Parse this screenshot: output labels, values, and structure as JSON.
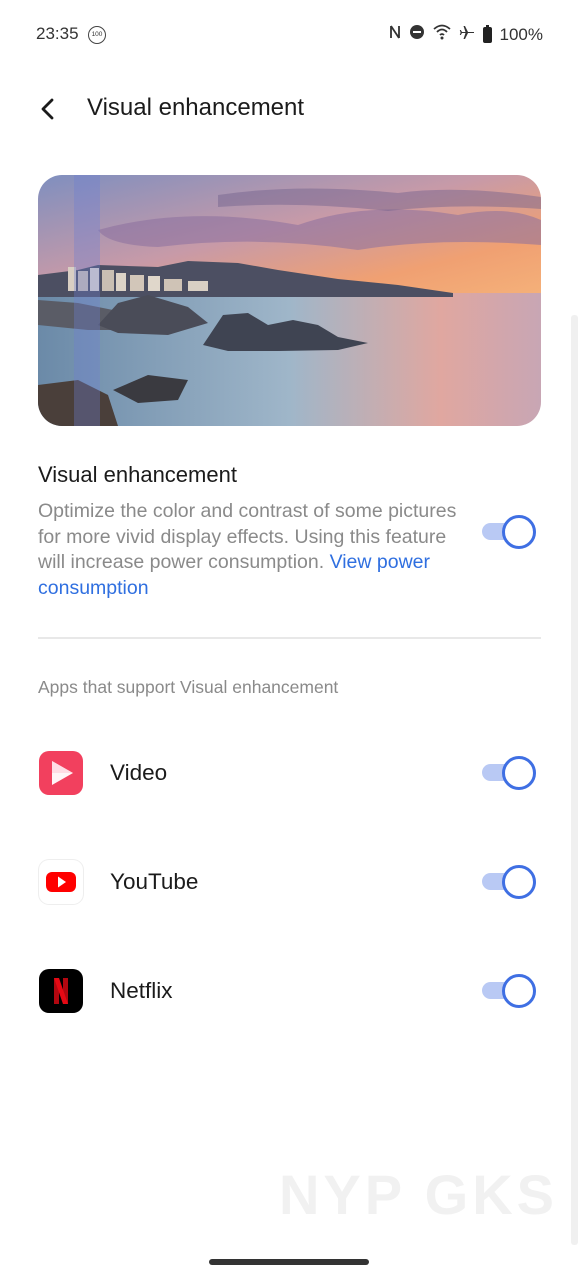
{
  "status_bar": {
    "time": "23:35",
    "notification_badge": "100",
    "battery": "100%",
    "icons": [
      "nfc-icon",
      "do-not-disturb-icon",
      "wifi-icon",
      "airplane-icon",
      "battery-icon"
    ]
  },
  "header": {
    "title": "Visual enhancement",
    "back_icon": "chevron-left-icon"
  },
  "feature": {
    "title": "Visual enhancement",
    "description": "Optimize the color and contrast of some pictures for more vivid display effects. Using this feature will increase power consumption.",
    "link": "View power consumption",
    "enabled": true
  },
  "apps_section": {
    "header": "Apps that support Visual enhancement",
    "apps": [
      {
        "name": "Video",
        "icon": "video-app-icon",
        "enabled": true
      },
      {
        "name": "YouTube",
        "icon": "youtube-app-icon",
        "enabled": true
      },
      {
        "name": "Netflix",
        "icon": "netflix-app-icon",
        "enabled": true
      }
    ]
  },
  "watermark": "NYP GKS",
  "colors": {
    "accent": "#3f6fe3",
    "toggle_track": "#b9c9f4",
    "link": "#2f6fe0",
    "secondary_text": "#8a8a8a"
  }
}
